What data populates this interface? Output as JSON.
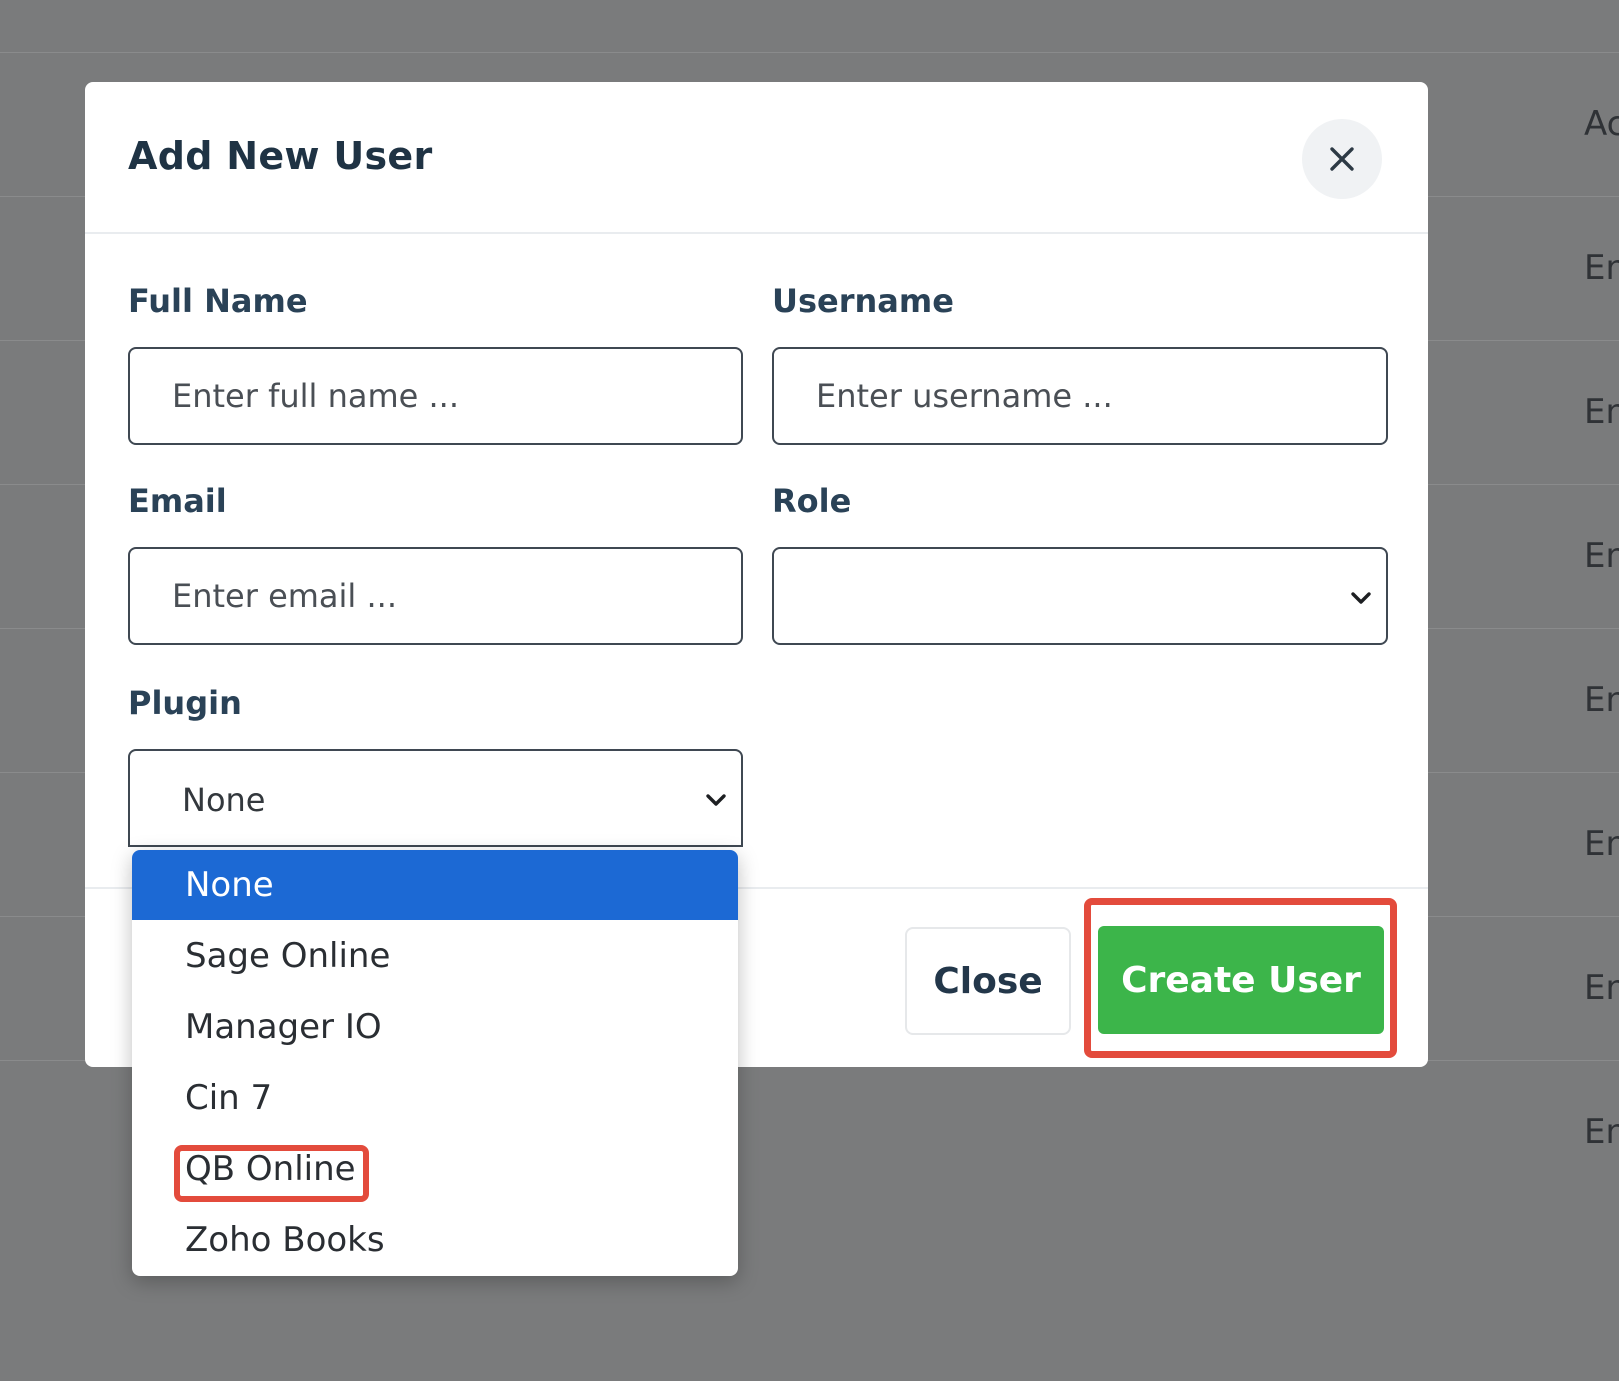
{
  "background": {
    "cells": [
      "Ac",
      "En",
      "En",
      "En",
      "En",
      "En",
      "En",
      "En"
    ]
  },
  "modal": {
    "title": "Add New User",
    "close_icon": "close-icon",
    "fields": {
      "full_name": {
        "label": "Full Name",
        "placeholder": "Enter full name ..."
      },
      "username": {
        "label": "Username",
        "placeholder": "Enter username ..."
      },
      "email": {
        "label": "Email",
        "placeholder": "Enter email ..."
      },
      "role": {
        "label": "Role",
        "value": ""
      },
      "plugin": {
        "label": "Plugin",
        "value": "None"
      }
    },
    "footer": {
      "close_label": "Close",
      "create_label": "Create User"
    }
  },
  "plugin_dropdown": {
    "options": [
      "None",
      "Sage Online",
      "Manager IO",
      "Cin 7",
      "QB Online",
      "Zoho Books"
    ],
    "selected": "None",
    "highlighted": "QB Online"
  },
  "colors": {
    "primary_select": "#1c69d4",
    "create_button": "#3cb54a",
    "annotation_highlight": "#e34b3c",
    "overlay": "#7a7b7c"
  }
}
